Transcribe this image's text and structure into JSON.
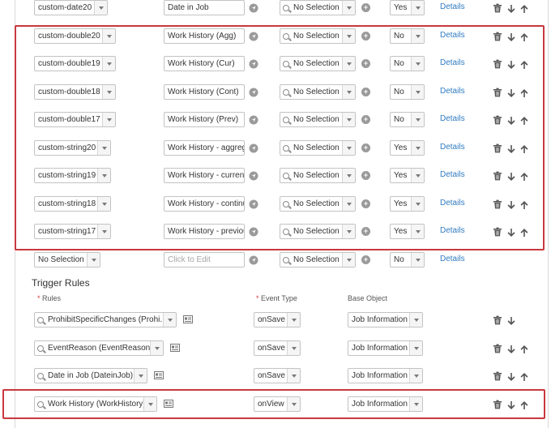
{
  "field_rows": [
    {
      "field": "custom-date20",
      "label": "Date in Job",
      "selection": "No Selection",
      "yesno": "Yes",
      "details": "Details",
      "up": true,
      "down": true
    },
    {
      "field": "custom-double20",
      "label": "Work History (Agg)",
      "selection": "No Selection",
      "yesno": "No",
      "details": "Details",
      "up": true,
      "down": true
    },
    {
      "field": "custom-double19",
      "label": "Work History (Cur)",
      "selection": "No Selection",
      "yesno": "No",
      "details": "Details",
      "up": true,
      "down": true
    },
    {
      "field": "custom-double18",
      "label": "Work History (Cont)",
      "selection": "No Selection",
      "yesno": "No",
      "details": "Details",
      "up": true,
      "down": true
    },
    {
      "field": "custom-double17",
      "label": "Work History (Prev)",
      "selection": "No Selection",
      "yesno": "No",
      "details": "Details",
      "up": true,
      "down": true
    },
    {
      "field": "custom-string20",
      "label": "Work History - aggregat",
      "selection": "No Selection",
      "yesno": "Yes",
      "details": "Details",
      "up": true,
      "down": true
    },
    {
      "field": "custom-string19",
      "label": "Work History - current (",
      "selection": "No Selection",
      "yesno": "Yes",
      "details": "Details",
      "up": true,
      "down": true
    },
    {
      "field": "custom-string18",
      "label": "Work History - continuo",
      "selection": "No Selection",
      "yesno": "Yes",
      "details": "Details",
      "up": true,
      "down": true
    },
    {
      "field": "custom-string17",
      "label": "Work History - previous",
      "selection": "No Selection",
      "yesno": "Yes",
      "details": "Details",
      "up": true,
      "down": false
    },
    {
      "field": "No Selection",
      "label_placeholder": "Click to Edit",
      "selection": "No Selection",
      "yesno": "No",
      "details": "Details",
      "up": false,
      "down": false,
      "no_delete": true
    }
  ],
  "trigger_rules": {
    "title": "Trigger Rules",
    "headers": {
      "rules": "Rules",
      "event_type": "Event Type",
      "base_object": "Base Object",
      "required_mark": "*"
    },
    "rows": [
      {
        "rule": "ProhibitSpecificChanges (Prohi...",
        "event": "onSave",
        "base": "Job Information",
        "up": false,
        "down": true
      },
      {
        "rule": "EventReason (EventReason)",
        "event": "onSave",
        "base": "Job Information",
        "up": true,
        "down": true
      },
      {
        "rule": "Date in Job (DateinJob)",
        "event": "onSave",
        "base": "Job Information",
        "up": true,
        "down": true
      },
      {
        "rule": "Work History (WorkHistory)",
        "event": "onView",
        "base": "Job Information",
        "up": true,
        "down": true
      }
    ]
  },
  "colors": {
    "highlight": "#c8383f",
    "link": "#2f7bbf"
  }
}
